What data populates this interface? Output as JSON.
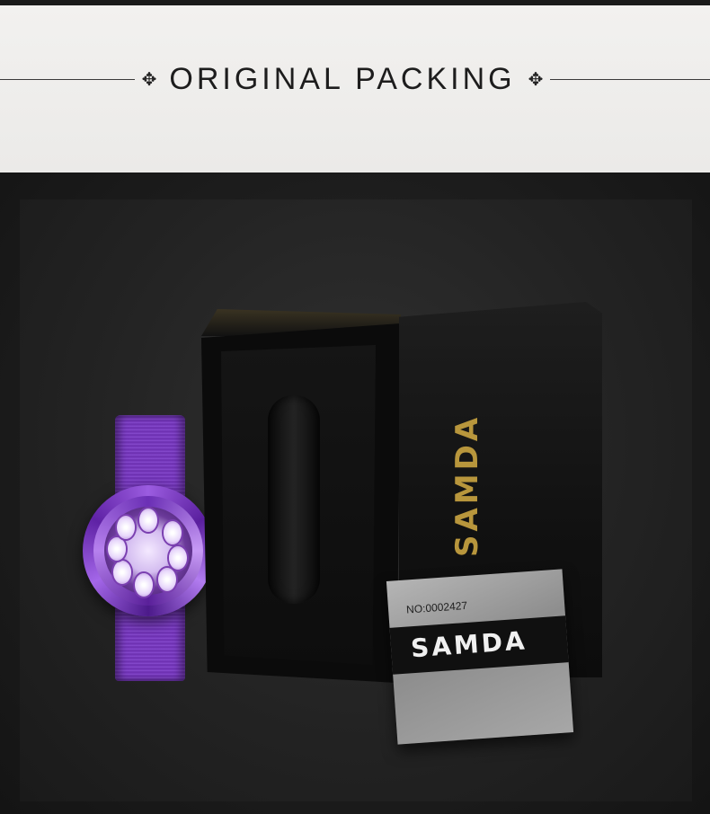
{
  "banner": {
    "title": "ORIGINAL PACKING",
    "deco_left": "✥",
    "deco_right": "✥"
  },
  "box": {
    "lid_brand": "SAMDA"
  },
  "card": {
    "serial": "NO:0002427",
    "brand": "SAMDA"
  },
  "colors": {
    "watch_purple": "#7c3fc4",
    "gold_logo": "#b8963c"
  }
}
